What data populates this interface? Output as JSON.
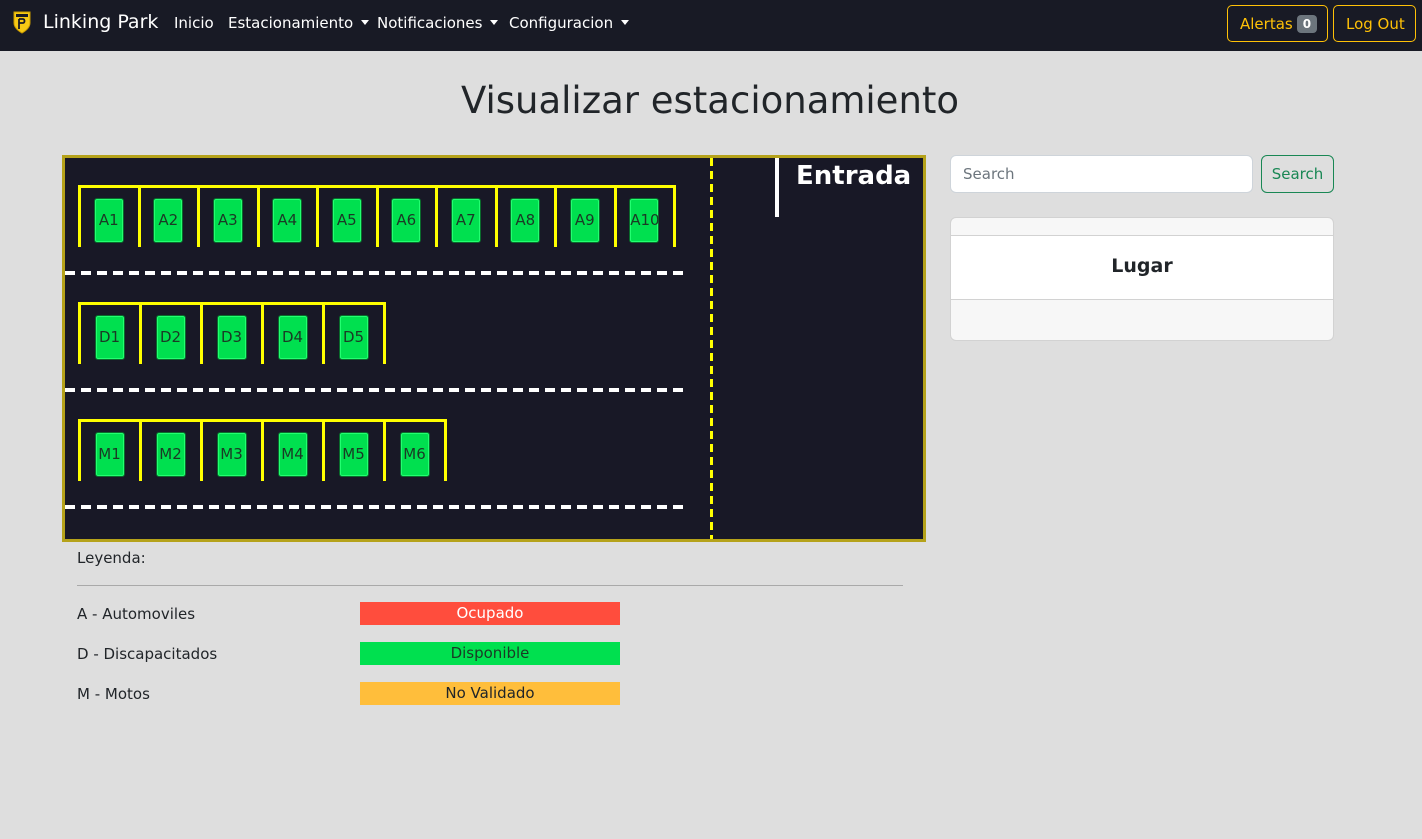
{
  "navbar": {
    "brand": "Linking Park",
    "items": [
      {
        "label": "Inicio",
        "dropdown": false
      },
      {
        "label": "Estacionamiento",
        "dropdown": true
      },
      {
        "label": "Notificaciones",
        "dropdown": true
      },
      {
        "label": "Configuracion",
        "dropdown": true
      }
    ],
    "alerts_label": "Alertas",
    "alerts_count": "0",
    "logout_label": "Log Out"
  },
  "page": {
    "title": "Visualizar estacionamiento"
  },
  "lot": {
    "entrance_label": "Entrada",
    "rows": [
      {
        "spots": [
          "A1",
          "A2",
          "A3",
          "A4",
          "A5",
          "A6",
          "A7",
          "A8",
          "A9",
          "A10"
        ]
      },
      {
        "spots": [
          "D1",
          "D2",
          "D3",
          "D4",
          "D5"
        ]
      },
      {
        "spots": [
          "M1",
          "M2",
          "M3",
          "M4",
          "M5",
          "M6"
        ]
      }
    ]
  },
  "search": {
    "placeholder": "Search",
    "value": "",
    "button_label": "Search"
  },
  "info_card": {
    "title": "Lugar"
  },
  "legend": {
    "title": "Leyenda:",
    "types": [
      "A - Automoviles",
      "D - Discapacitados",
      "M - Motos"
    ],
    "statuses": [
      {
        "label": "Ocupado",
        "color": "#ff4d3d",
        "text_color": "#ffffff"
      },
      {
        "label": "Disponible",
        "color": "#00e04f",
        "text_color": "#1a3a25"
      },
      {
        "label": "No Validado",
        "color": "#ffbe3b",
        "text_color": "#212529"
      }
    ]
  },
  "colors": {
    "navbar_bg": "#181a25",
    "page_bg": "#dedede",
    "lot_bg": "#181826",
    "lot_border": "#b5a21a",
    "line_yellow": "#ffff00",
    "spot_available": "#00e04f",
    "warning": "#ffc107",
    "success": "#198754"
  }
}
